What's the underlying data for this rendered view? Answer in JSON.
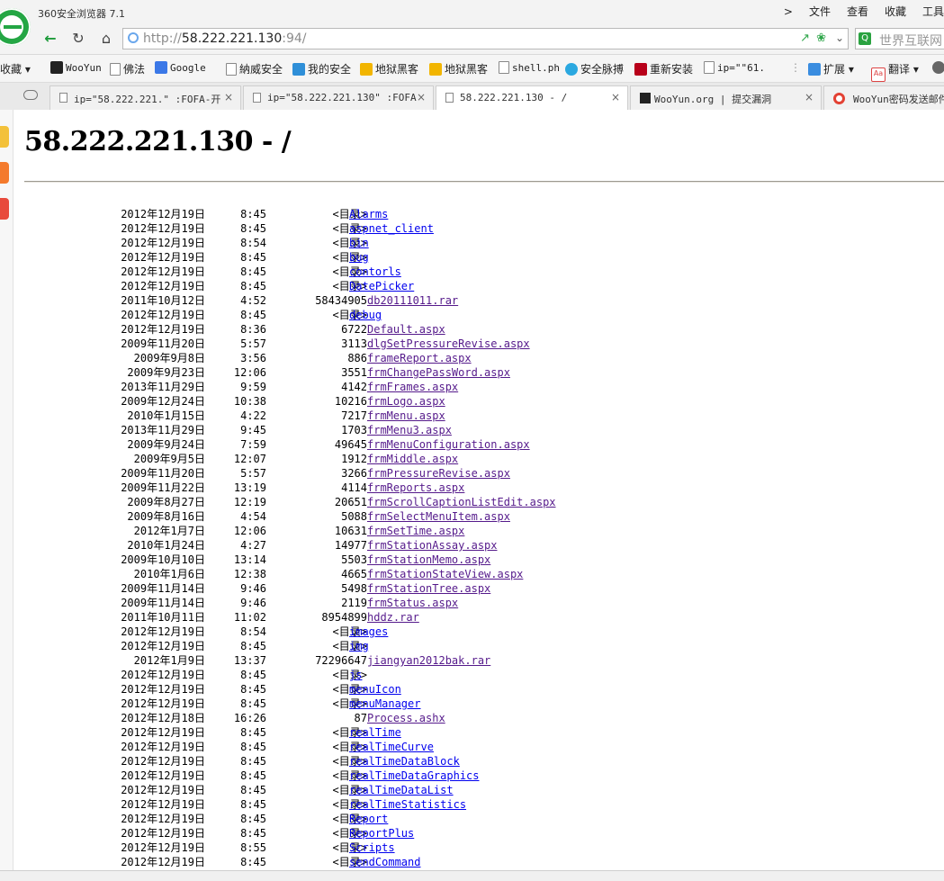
{
  "window": {
    "app_title": "360安全浏览器 7.1",
    "menu": [
      "文件",
      "查看",
      "收藏",
      "工具"
    ],
    "menu_arrow": ">"
  },
  "nav": {
    "back_icon": "arrow-left-icon",
    "refresh_icon": "refresh-icon",
    "home_icon": "home-icon",
    "url_scheme": "http://",
    "url_host": "58.222.221.130",
    "url_rest": ":94/",
    "search_placeholder": "世界互联网"
  },
  "bookmarks": [
    {
      "label": "收藏",
      "icon": "none"
    },
    {
      "label": "WooYun",
      "icon": "wooyun-icon"
    },
    {
      "label": "佛法",
      "icon": "document-icon"
    },
    {
      "label": "Google",
      "icon": "google-icon"
    },
    {
      "label": "納威安全",
      "icon": "document-icon"
    },
    {
      "label": "我的安全",
      "icon": "shield-icon"
    },
    {
      "label": "地狱黑客",
      "icon": "bookmark-icon"
    },
    {
      "label": "地狱黑客",
      "icon": "bookmark-icon"
    },
    {
      "label": "shell.ph",
      "icon": "document-icon"
    },
    {
      "label": "安全脉搏",
      "icon": "cloud-icon"
    },
    {
      "label": "重新安装",
      "icon": "red-v-icon"
    },
    {
      "label": "ip=\"\"61.",
      "icon": "document-icon"
    },
    {
      "label": "扩展",
      "icon": "grid-icon"
    },
    {
      "label": "翻译",
      "icon": "translate-icon"
    }
  ],
  "tabs": [
    {
      "label": "ip=\"58.222.221.\" :FOFA-开",
      "active": false,
      "icon": "document-icon"
    },
    {
      "label": "ip=\"58.222.221.130\" :FOFA",
      "active": false,
      "icon": "document-icon"
    },
    {
      "label": "58.222.221.130 - /",
      "active": true,
      "icon": "document-icon"
    },
    {
      "label": "WooYun.org | 提交漏洞",
      "active": false,
      "icon": "wooyun-icon"
    },
    {
      "label": "WooYun密码发送邮件",
      "active": false,
      "icon": "chrome-icon"
    }
  ],
  "tab_close": "×",
  "page": {
    "title": "58.222.221.130 - /",
    "entries": [
      {
        "date": "2012年12月19日",
        "time": "8:45",
        "size": "<目录>",
        "name": "Alarms",
        "dir": true
      },
      {
        "date": "2012年12月19日",
        "time": "8:45",
        "size": "<目录>",
        "name": "aspnet_client",
        "dir": true
      },
      {
        "date": "2012年12月19日",
        "time": "8:54",
        "size": "<目录>",
        "name": "bin",
        "dir": true
      },
      {
        "date": "2012年12月19日",
        "time": "8:45",
        "size": "<目录>",
        "name": "bug",
        "dir": true
      },
      {
        "date": "2012年12月19日",
        "time": "8:45",
        "size": "<目录>",
        "name": "contorls",
        "dir": true
      },
      {
        "date": "2012年12月19日",
        "time": "8:45",
        "size": "<目录>",
        "name": "DatePicker",
        "dir": true
      },
      {
        "date": "2011年10月12日",
        "time": "4:52",
        "size": "58434905",
        "name": "db20111011.rar",
        "dir": false
      },
      {
        "date": "2012年12月19日",
        "time": "8:45",
        "size": "<目录>",
        "name": "debug",
        "dir": true
      },
      {
        "date": "2012年12月19日",
        "time": "8:36",
        "size": "6722",
        "name": "Default.aspx",
        "dir": false
      },
      {
        "date": "2009年11月20日",
        "time": "5:57",
        "size": "3113",
        "name": "dlgSetPressureRevise.aspx",
        "dir": false
      },
      {
        "date": "2009年9月8日",
        "time": "3:56",
        "size": "886",
        "name": "frameReport.aspx",
        "dir": false
      },
      {
        "date": "2009年9月23日",
        "time": "12:06",
        "size": "3551",
        "name": "frmChangePassWord.aspx",
        "dir": false
      },
      {
        "date": "2013年11月29日",
        "time": "9:59",
        "size": "4142",
        "name": "frmFrames.aspx",
        "dir": false
      },
      {
        "date": "2009年12月24日",
        "time": "10:38",
        "size": "10216",
        "name": "frmLogo.aspx",
        "dir": false
      },
      {
        "date": "2010年1月15日",
        "time": "4:22",
        "size": "7217",
        "name": "frmMenu.aspx",
        "dir": false
      },
      {
        "date": "2013年11月29日",
        "time": "9:45",
        "size": "1703",
        "name": "frmMenu3.aspx",
        "dir": false
      },
      {
        "date": "2009年9月24日",
        "time": "7:59",
        "size": "49645",
        "name": "frmMenuConfiguration.aspx",
        "dir": false
      },
      {
        "date": "2009年9月5日",
        "time": "12:07",
        "size": "1912",
        "name": "frmMiddle.aspx",
        "dir": false
      },
      {
        "date": "2009年11月20日",
        "time": "5:57",
        "size": "3266",
        "name": "frmPressureRevise.aspx",
        "dir": false
      },
      {
        "date": "2009年11月22日",
        "time": "13:19",
        "size": "4114",
        "name": "frmReports.aspx",
        "dir": false
      },
      {
        "date": "2009年8月27日",
        "time": "12:19",
        "size": "20651",
        "name": "frmScrollCaptionListEdit.aspx",
        "dir": false
      },
      {
        "date": "2009年8月16日",
        "time": "4:54",
        "size": "5088",
        "name": "frmSelectMenuItem.aspx",
        "dir": false
      },
      {
        "date": "2012年1月7日",
        "time": "12:06",
        "size": "10631",
        "name": "frmSetTime.aspx",
        "dir": false
      },
      {
        "date": "2010年1月24日",
        "time": "4:27",
        "size": "14977",
        "name": "frmStationAssay.aspx",
        "dir": false
      },
      {
        "date": "2009年10月10日",
        "time": "13:14",
        "size": "5503",
        "name": "frmStationMemo.aspx",
        "dir": false
      },
      {
        "date": "2010年1月6日",
        "time": "12:38",
        "size": "4665",
        "name": "frmStationStateView.aspx",
        "dir": false
      },
      {
        "date": "2009年11月14日",
        "time": "9:46",
        "size": "5498",
        "name": "frmStationTree.aspx",
        "dir": false
      },
      {
        "date": "2009年11月14日",
        "time": "9:46",
        "size": "2119",
        "name": "frmStatus.aspx",
        "dir": false
      },
      {
        "date": "2011年10月11日",
        "time": "11:02",
        "size": "8954899",
        "name": "hddz.rar",
        "dir": false
      },
      {
        "date": "2012年12月19日",
        "time": "8:54",
        "size": "<目录>",
        "name": "images",
        "dir": true
      },
      {
        "date": "2012年12月19日",
        "time": "8:45",
        "size": "<目录>",
        "name": "img",
        "dir": true
      },
      {
        "date": "2012年1月9日",
        "time": "13:37",
        "size": "72296647",
        "name": "jiangyan2012bak.rar",
        "dir": false
      },
      {
        "date": "2012年12月19日",
        "time": "8:45",
        "size": "<目录>",
        "name": "js",
        "dir": true
      },
      {
        "date": "2012年12月19日",
        "time": "8:45",
        "size": "<目录>",
        "name": "menuIcon",
        "dir": true
      },
      {
        "date": "2012年12月19日",
        "time": "8:45",
        "size": "<目录>",
        "name": "menuManager",
        "dir": true
      },
      {
        "date": "2012年12月18日",
        "time": "16:26",
        "size": "87",
        "name": "Process.ashx",
        "dir": false
      },
      {
        "date": "2012年12月19日",
        "time": "8:45",
        "size": "<目录>",
        "name": "realTime",
        "dir": true
      },
      {
        "date": "2012年12月19日",
        "time": "8:45",
        "size": "<目录>",
        "name": "realTimeCurve",
        "dir": true
      },
      {
        "date": "2012年12月19日",
        "time": "8:45",
        "size": "<目录>",
        "name": "realTimeDataBlock",
        "dir": true
      },
      {
        "date": "2012年12月19日",
        "time": "8:45",
        "size": "<目录>",
        "name": "realTimeDataGraphics",
        "dir": true
      },
      {
        "date": "2012年12月19日",
        "time": "8:45",
        "size": "<目录>",
        "name": "realTimeDataList",
        "dir": true
      },
      {
        "date": "2012年12月19日",
        "time": "8:45",
        "size": "<目录>",
        "name": "realTimeStatistics",
        "dir": true
      },
      {
        "date": "2012年12月19日",
        "time": "8:45",
        "size": "<目录>",
        "name": "Report",
        "dir": true
      },
      {
        "date": "2012年12月19日",
        "time": "8:45",
        "size": "<目录>",
        "name": "ReportPlus",
        "dir": true
      },
      {
        "date": "2012年12月19日",
        "time": "8:55",
        "size": "<目录>",
        "name": "Scripts",
        "dir": true
      },
      {
        "date": "2012年12月19日",
        "time": "8:45",
        "size": "<目录>",
        "name": "sendCommand",
        "dir": true
      }
    ]
  },
  "colors": {
    "link": "#0000ee",
    "visited_link": "#551a8b",
    "accent_green": "#24a644"
  }
}
